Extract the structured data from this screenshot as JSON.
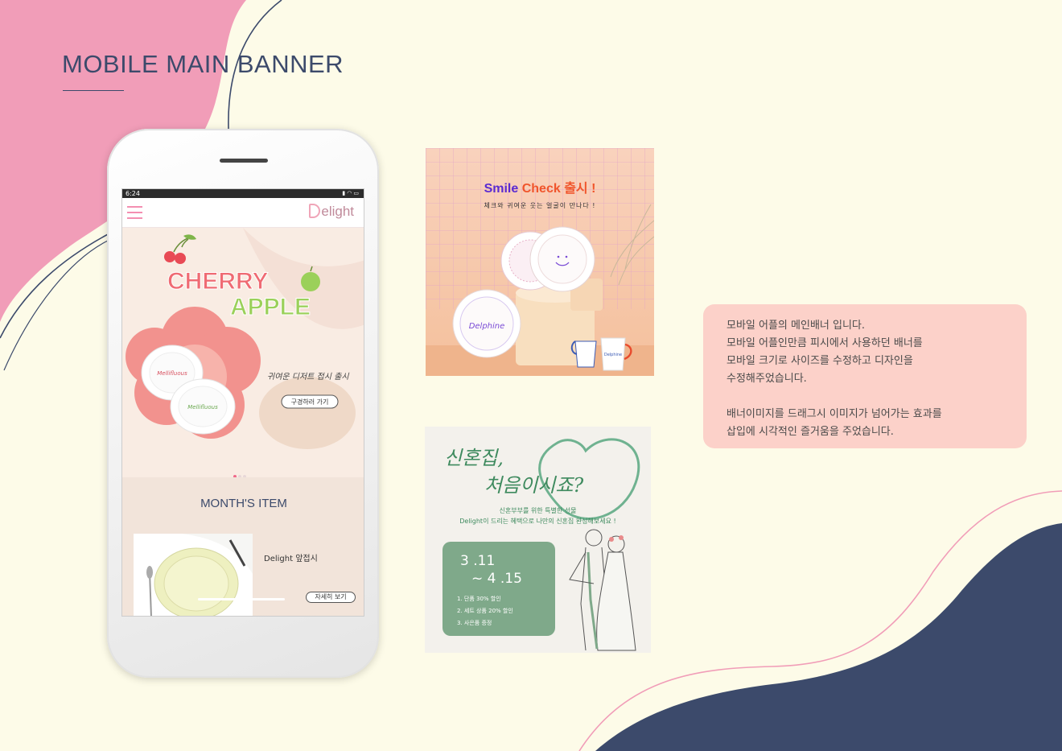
{
  "page": {
    "title": "MOBILE MAIN BANNER",
    "colors": {
      "pink": "#f19db8",
      "navy": "#3c4a6b",
      "cream": "#fdfbe8",
      "peach": "#fcd1c9",
      "green": "#7fa98a"
    }
  },
  "phone": {
    "status_time": "6:24",
    "status_icons": "signal-icon wifi-icon battery-icon",
    "brand": "elight",
    "hero": {
      "title_line1": "CHERRY",
      "title_line2": "APPLE",
      "tagline": "귀여운 디저트 접시 출시",
      "cta": "구경하러 가기",
      "plate_text": "Mellifluous",
      "slide_count": 3,
      "active_slide": 1
    },
    "month_section": {
      "title": "MONTH'S ITEM",
      "item_name": "Delight 앞접시",
      "item_button": "자세히 보기"
    }
  },
  "banner_smile": {
    "title_a": "Smile",
    "title_b": "Check 출시 !",
    "subtitle": "체크와 귀여운 웃는 얼굴이 만나다 !",
    "plate_text": "Delphine",
    "mug_text": "Delphine"
  },
  "banner_wedding": {
    "headline_line1": "신혼집,",
    "headline_line2": "처음이시죠?",
    "sub_line1": "신혼부부를 위한 특별한 선물",
    "sub_line2": "Delight이 드리는 혜택으로 나만의 신혼집 완성해보세요 !",
    "date_start": "3 .11",
    "date_end": "~ 4 .15",
    "benefits": [
      "1. 단품 30% 할인",
      "2. 세트 상품 20% 할인",
      "3. 사은품 증정"
    ]
  },
  "description": {
    "para1": [
      "모바일 어플의 메인배너 입니다.",
      "모바일 어플인만큼 피시에서 사용하던 배너를",
      "모바일 크기로 사이즈를 수정하고 디자인을",
      "수정해주었습니다."
    ],
    "para2": [
      "배너이미지를 드래그시 이미지가 넘어가는 효과를",
      "삽입에 시각적인 즐거움을 주었습니다."
    ]
  }
}
